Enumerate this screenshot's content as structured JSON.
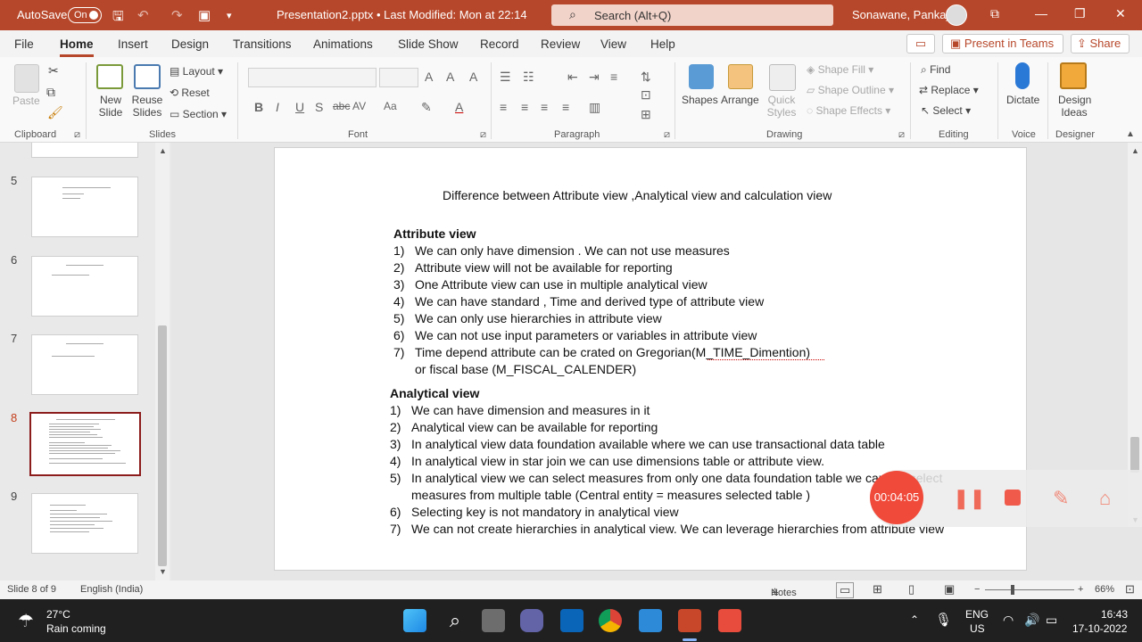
{
  "titlebar": {
    "autosave_label": "AutoSave",
    "autosave_state": "On",
    "doc_title": "Presentation2.pptx • Last Modified: Mon at 22:14",
    "search_placeholder": "Search (Alt+Q)",
    "user_name": "Sonawane, Pankaj"
  },
  "menu": {
    "tabs": [
      "File",
      "Home",
      "Insert",
      "Design",
      "Transitions",
      "Animations",
      "Slide Show",
      "Record",
      "Review",
      "View",
      "Help"
    ],
    "present_label": "Present in Teams",
    "share_label": "Share"
  },
  "ribbon": {
    "clipboard": {
      "paste": "Paste",
      "group": "Clipboard"
    },
    "slides": {
      "new_slide": "New Slide",
      "reuse": "Reuse Slides",
      "layout": "Layout",
      "reset": "Reset",
      "section": "Section",
      "group": "Slides"
    },
    "font_group": "Font",
    "paragraph_group": "Paragraph",
    "drawing": {
      "shapes": "Shapes",
      "arrange": "Arrange",
      "quick_styles": "Quick Styles",
      "fill": "Shape Fill",
      "outline": "Shape Outline",
      "effects": "Shape Effects",
      "group": "Drawing"
    },
    "editing": {
      "find": "Find",
      "replace": "Replace",
      "select": "Select",
      "group": "Editing"
    },
    "voice": {
      "dictate": "Dictate",
      "group": "Voice"
    },
    "designer": {
      "ideas": "Design Ideas",
      "group": "Designer"
    }
  },
  "thumbnails": {
    "numbers": [
      "5",
      "6",
      "7",
      "8",
      "9"
    ],
    "selected": "8"
  },
  "slide": {
    "title": "Difference between Attribute view ,Analytical view and calculation view",
    "sections": [
      {
        "heading": "Attribute view",
        "items": [
          {
            "n": "1)",
            "text": "We can only have dimension . We can not use measures"
          },
          {
            "n": "2)",
            "text": "Attribute view will not be available  for reporting"
          },
          {
            "n": "3)",
            "text": "One Attribute view can use in multiple analytical view"
          },
          {
            "n": "4)",
            "text": "We can have standard , Time and derived type of attribute view"
          },
          {
            "n": "5)",
            "text": "We can only use hierarchies in attribute view"
          },
          {
            "n": "6)",
            "text": "We can not use input parameters or variables in attribute view"
          },
          {
            "n": "7)",
            "text": "Time depend attribute can be crated on Gregorian(M_TIME_Dimention)"
          },
          {
            "n": "",
            "text": "or fiscal base  (M_FISCAL_CALENDER)"
          }
        ]
      },
      {
        "heading": "Analytical view",
        "items": [
          {
            "n": "1)",
            "text": "We can have dimension and measures in it"
          },
          {
            "n": "2)",
            "text": "Analytical view can be available for reporting"
          },
          {
            "n": "3)",
            "text": "In analytical view data foundation available  where we can use transactional data table"
          },
          {
            "n": "4)",
            "text": "In analytical view in star join we can use dimensions table or attribute view."
          },
          {
            "n": "5)",
            "text": "In analytical  view we can select measures from only one data foundation table we can not  select"
          },
          {
            "n": "",
            "text": "measures from multiple table (Central entity = measures selected table )"
          },
          {
            "n": "6)",
            "text": "Selecting key is not mandatory in analytical view"
          },
          {
            "n": "7)",
            "text": "We can not create hierarchies in analytical view. We can leverage hierarchies from attribute view"
          }
        ]
      }
    ]
  },
  "recorder": {
    "time": "00:04:05"
  },
  "status": {
    "slide_of": "Slide 8 of 9",
    "language": "English (India)",
    "notes": "Notes",
    "zoom": "66%"
  },
  "taskbar": {
    "temp": "27°C",
    "weather": "Rain coming",
    "lang1": "ENG",
    "lang2": "US",
    "time": "16:43",
    "date": "17-10-2022"
  },
  "colors": {
    "accent": "#b7472a",
    "selected_thumb": "#8c1c1c",
    "record": "#f04a3a"
  }
}
